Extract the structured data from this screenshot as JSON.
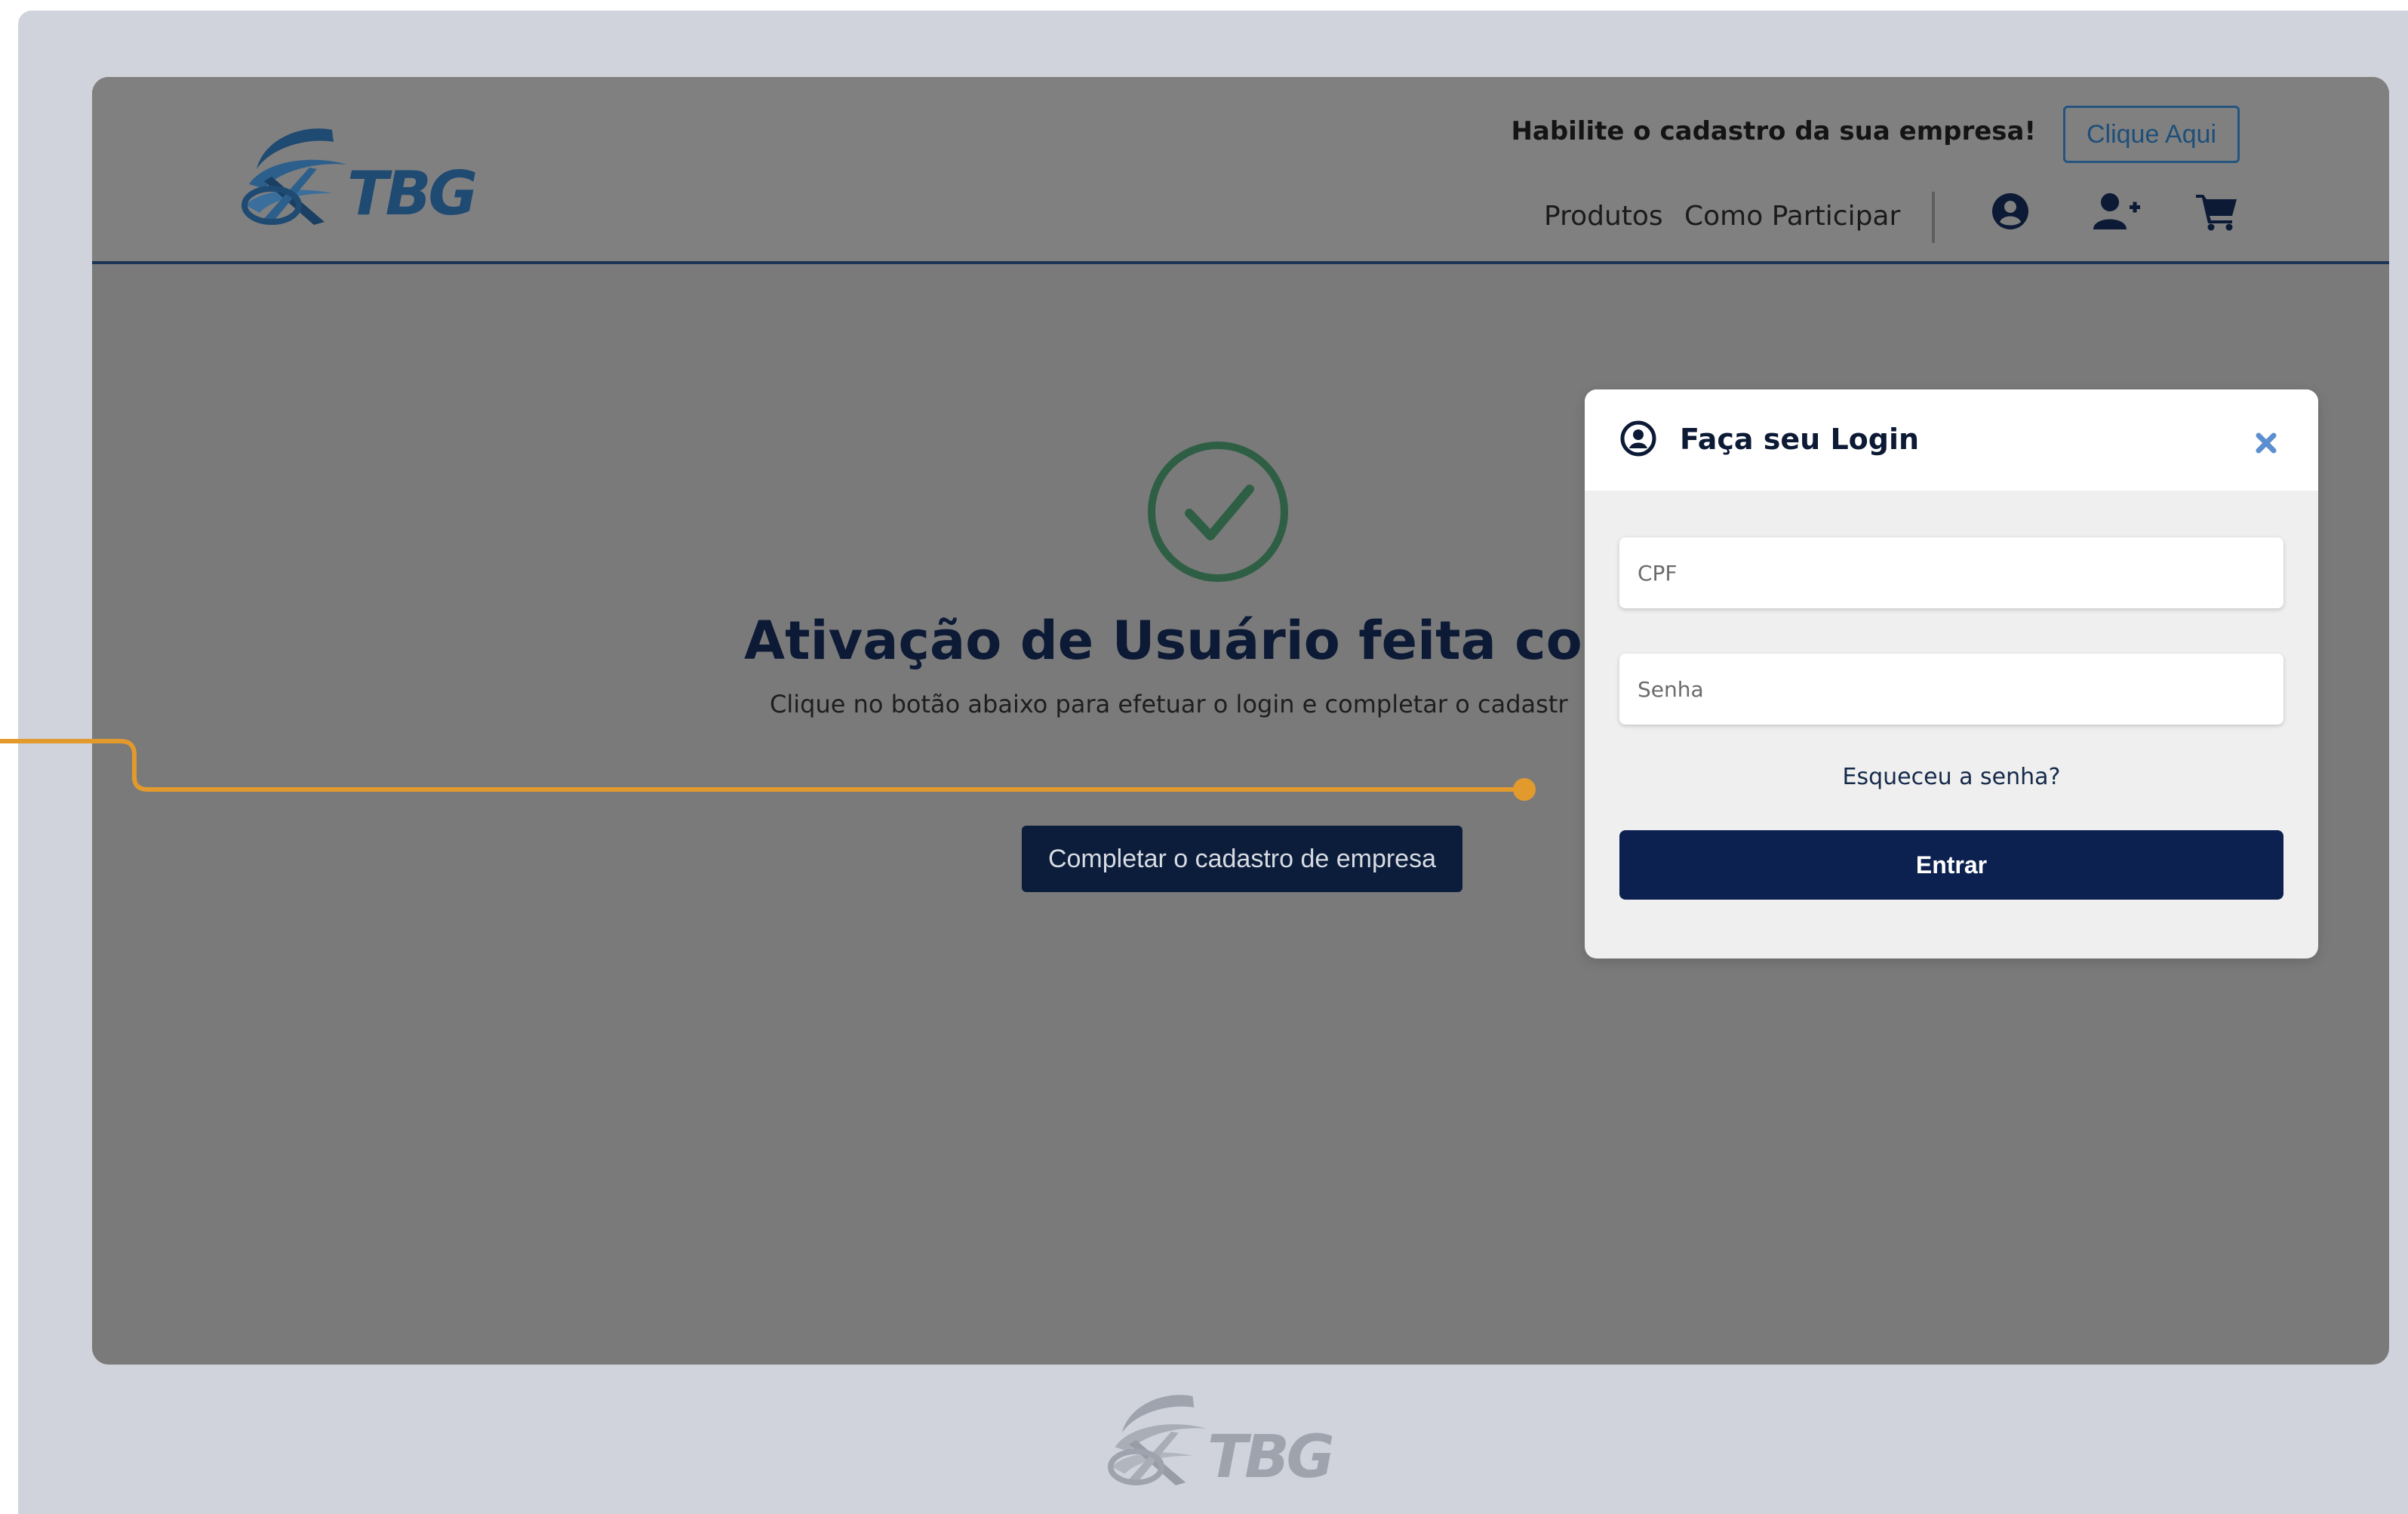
{
  "header": {
    "logo_text": "TBG",
    "banner_text": "Habilite o cadastro da sua empresa!",
    "cta_label": "Clique Aqui",
    "nav": [
      "Produtos",
      "Como Participar"
    ],
    "icons": [
      "user-circle-icon",
      "user-plus-icon",
      "cart-icon"
    ]
  },
  "main": {
    "title": "Ativação de Usuário feita com",
    "subtitle": "Clique no botão abaixo para efetuar o login e completar o cadastr",
    "button_label": "Completar o cadastro de empresa"
  },
  "login_modal": {
    "title": "Faça seu Login",
    "cpf_placeholder": "CPF",
    "password_placeholder": "Senha",
    "forgot_label": "Esqueceu a senha?",
    "submit_label": "Entrar"
  },
  "footer": {
    "logo_text": "TBG"
  },
  "colors": {
    "overlay": "#7a7a7a",
    "navy": "#0c1d3b",
    "brand_blue": "#23557f",
    "success_green": "#2e5f45",
    "callout_orange": "#e39a2d",
    "outer_frame": "#d0d3db"
  }
}
